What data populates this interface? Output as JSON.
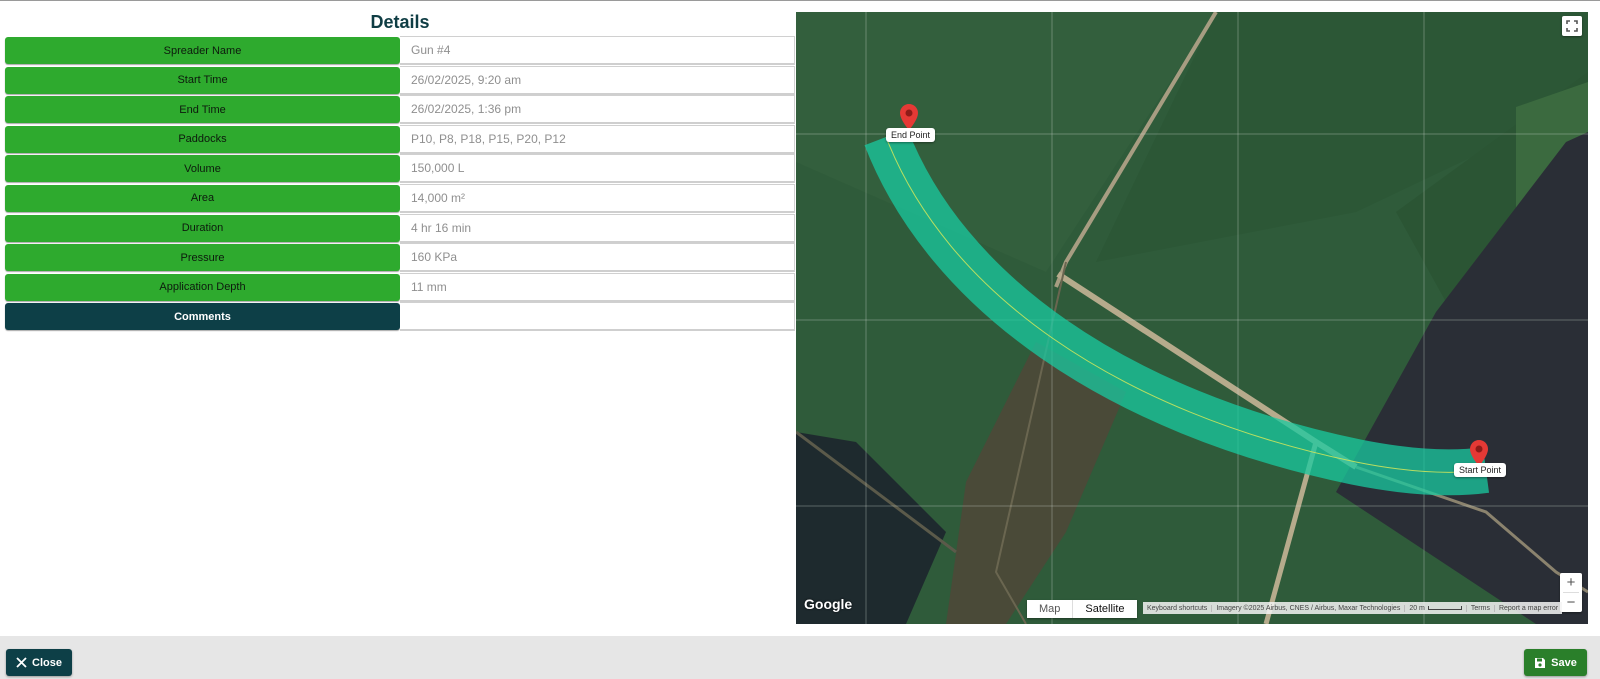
{
  "details": {
    "title": "Details",
    "rows": [
      {
        "label": "Spreader Name",
        "value": "Gun #4"
      },
      {
        "label": "Start Time",
        "value": "26/02/2025, 9:20 am"
      },
      {
        "label": "End Time",
        "value": "26/02/2025, 1:36 pm"
      },
      {
        "label": "Paddocks",
        "value": "P10, P8, P18, P15, P20, P12"
      },
      {
        "label": "Volume",
        "value": "150,000 L"
      },
      {
        "label": "Area",
        "value": "14,000 m²"
      },
      {
        "label": "Duration",
        "value": "4 hr 16 min"
      },
      {
        "label": "Pressure",
        "value": "160 KPa"
      },
      {
        "label": "Application Depth",
        "value": "11 mm"
      },
      {
        "label": "Comments",
        "value": ""
      }
    ]
  },
  "map": {
    "end_point_label": "End Point",
    "start_point_label": "Start Point",
    "map_type": {
      "map": "Map",
      "satellite": "Satellite",
      "selected": "Satellite"
    },
    "zoom_in": "+",
    "zoom_out": "−",
    "logo": "Google",
    "attribution": {
      "shortcuts": "Keyboard shortcuts",
      "imagery": "Imagery ©2025 Airbus, CNES / Airbus, Maxar Technologies",
      "scale": "20 m",
      "terms": "Terms",
      "report": "Report a map error"
    },
    "colors": {
      "track": "#19c9a0",
      "marker": "#e53935"
    }
  },
  "footer": {
    "close_label": "Close",
    "save_label": "Save"
  },
  "colors": {
    "label_green": "#2eaa2e",
    "label_dark": "#0d3f47",
    "title": "#0f3d44",
    "save_button": "#2a7f2a"
  }
}
